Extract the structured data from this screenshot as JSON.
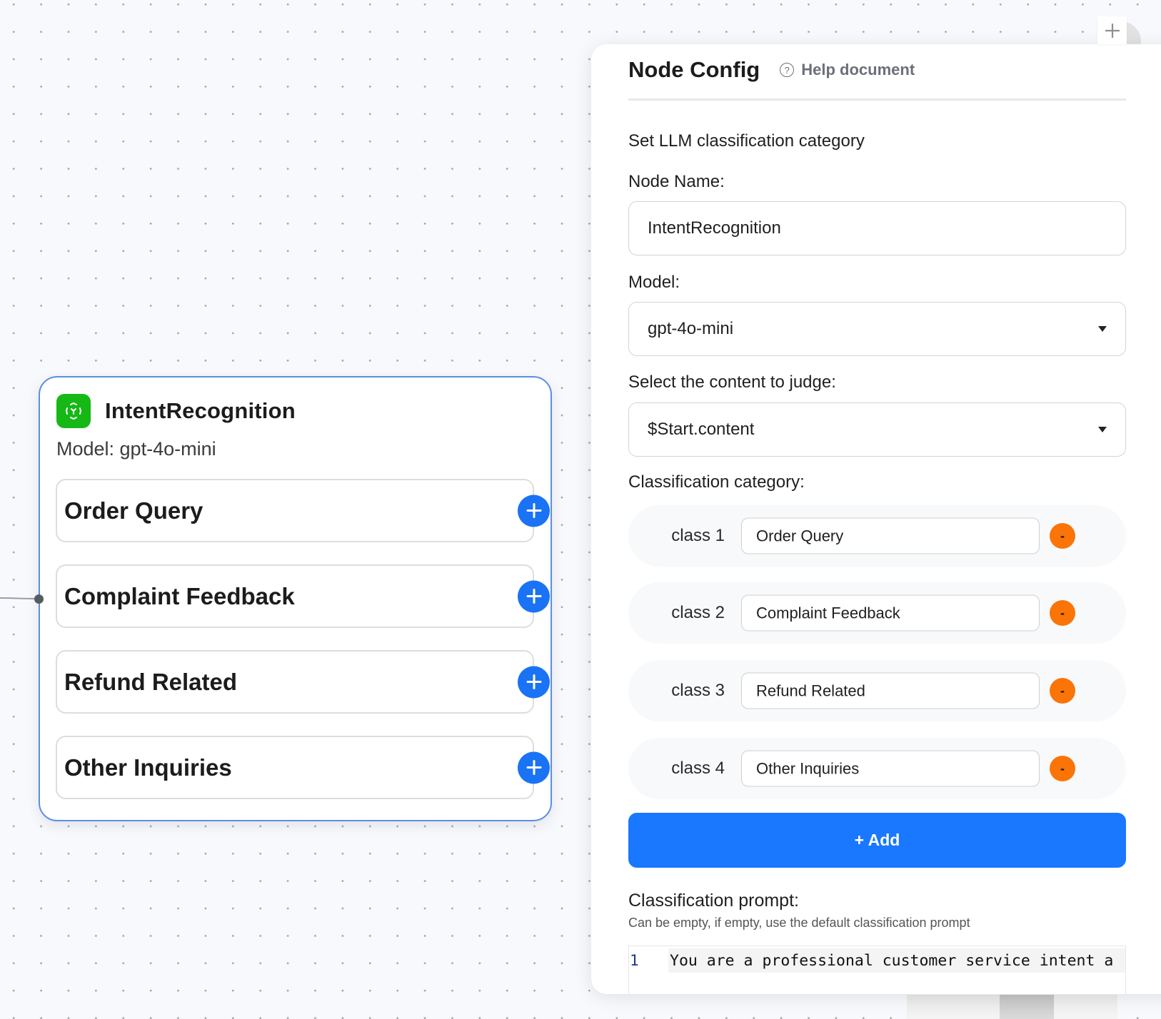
{
  "canvas": {
    "node": {
      "title": "IntentRecognition",
      "subtitle": "Model: gpt-4o-mini",
      "icon": "intent-recognition-icon",
      "icon_color": "#16b816",
      "items": [
        {
          "label": "Order Query"
        },
        {
          "label": "Complaint Feedback"
        },
        {
          "label": "Refund Related"
        },
        {
          "label": "Other Inquiries"
        }
      ]
    },
    "zoom_in_icon": "plus-icon"
  },
  "panel": {
    "title": "Node Config",
    "help_icon": "question-circle-icon",
    "help_label": "Help document",
    "description": "Set LLM classification category",
    "node_name": {
      "label": "Node Name:",
      "value": "IntentRecognition"
    },
    "model": {
      "label": "Model:",
      "value": "gpt-4o-mini"
    },
    "content": {
      "label": "Select the content to judge:",
      "value": "$Start.content"
    },
    "classification": {
      "label": "Classification category:",
      "classes": [
        {
          "label": "class 1",
          "value": "Order Query",
          "remove": "-"
        },
        {
          "label": "class 2",
          "value": "Complaint Feedback",
          "remove": "-"
        },
        {
          "label": "class 3",
          "value": "Refund Related",
          "remove": "-"
        },
        {
          "label": "class 4",
          "value": "Other Inquiries",
          "remove": "-"
        }
      ],
      "add_label": "+ Add"
    },
    "prompt": {
      "label": "Classification prompt:",
      "hint": "Can be empty, if empty, use the default classification prompt",
      "lines": [
        {
          "number": "1",
          "text": "You are a professional customer service intent a"
        }
      ]
    }
  },
  "colors": {
    "accent": "#1a77ff",
    "remove": "#fa7408",
    "node_border": "#5b8fe0"
  }
}
